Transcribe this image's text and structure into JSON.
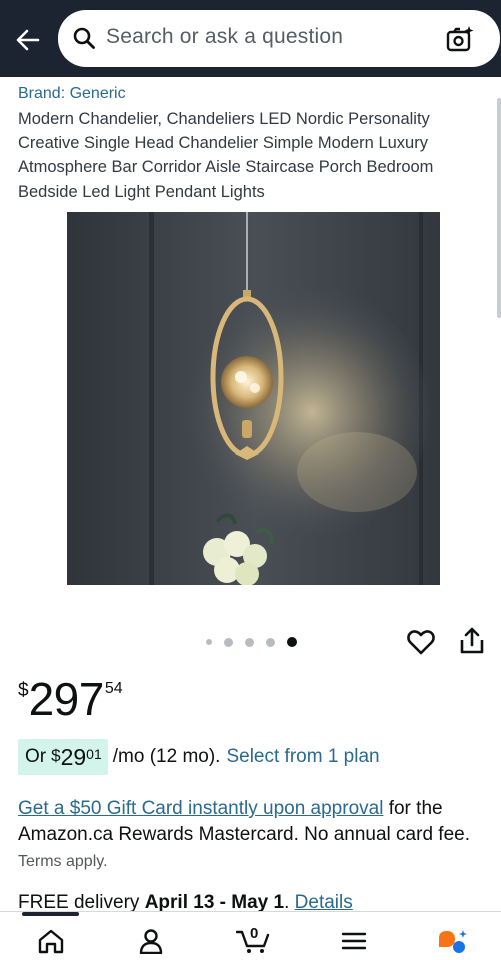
{
  "header": {
    "search_placeholder": "Search or ask a question"
  },
  "product": {
    "brand": "Brand: Generic",
    "title": "Modern Chandelier, Chandeliers LED Nordic Personality Creative Single Head Chandelier Simple Modern Luxury Atmosphere Bar Corridor Aisle Staircase Porch Bedroom Bedside Led Light Pendant Lights",
    "image_count": 5,
    "active_image_index": 4
  },
  "price": {
    "symbol": "$",
    "whole": "297",
    "fraction": "54"
  },
  "monthly": {
    "prefix": "Or",
    "symbol": "$",
    "amount": "29",
    "cents": "01",
    "suffix": "/mo (12 mo).",
    "link": "Select from 1 plan"
  },
  "gift_card": {
    "link": "Get a $50 Gift Card instantly upon approval",
    "text": " for the Amazon.ca Rewards Mastercard. No annual card fee.",
    "terms": "Terms apply."
  },
  "delivery": {
    "free": "FREE delivery",
    "dates": "April 13 - May 1",
    "period": ".",
    "details": "Details"
  },
  "cart": {
    "count": "0"
  },
  "colors": {
    "header_bg": "#1b2430",
    "link": "#2a6a8f",
    "monthly_bg": "#d3f4ea",
    "price_text": "#0f1111"
  },
  "icons": [
    "back-arrow-icon",
    "search-icon",
    "camera-search-icon",
    "heart-icon",
    "share-icon",
    "home-icon",
    "account-icon",
    "cart-icon",
    "menu-icon",
    "rufus-ai-icon"
  ]
}
